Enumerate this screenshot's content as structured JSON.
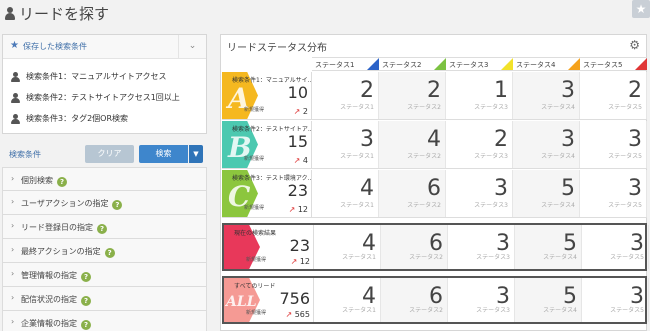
{
  "page": {
    "title": "リードを探す",
    "star_icon": "star-icon"
  },
  "saved": {
    "heading": "保存した検索条件",
    "items": [
      "検索条件1：マニュアルサイトアクセス",
      "検索条件2：テストサイトアクセス1回以上",
      "検索条件3：タグ2個OR検索"
    ]
  },
  "conditions": {
    "label": "検索条件",
    "clear": "クリア",
    "search": "検索",
    "filters": [
      "個別検索",
      "ユーザアクションの指定",
      "リード登録日の指定",
      "最終アクションの指定",
      "管理情報の指定",
      "配信状況の指定",
      "企業情報の指定"
    ]
  },
  "status": {
    "title": "リードステータス分布",
    "columns": [
      {
        "label": "ステータス1",
        "color": "#2c63c8"
      },
      {
        "label": "ステータス2",
        "color": "#7cc242"
      },
      {
        "label": "ステータス3",
        "color": "#f2e22a"
      },
      {
        "label": "ステータス4",
        "color": "#f5a21c"
      },
      {
        "label": "ステータス5",
        "color": "#e03535"
      }
    ],
    "rows": [
      {
        "name": "検索条件1：マニュアルサイ...",
        "count": "10",
        "sub": "新規獲得",
        "trend": "2",
        "letter": "A",
        "color": "#f5b820",
        "values": [
          "2",
          "2",
          "1",
          "3",
          "2"
        ]
      },
      {
        "name": "検索条件2：テストサイトア...",
        "count": "15",
        "sub": "新規獲得",
        "trend": "4",
        "letter": "B",
        "color": "#4cc9b0",
        "values": [
          "3",
          "4",
          "2",
          "3",
          "3"
        ]
      },
      {
        "name": "検索条件3：テスト環境アク...",
        "count": "23",
        "sub": "新規獲得",
        "trend": "12",
        "letter": "C",
        "color": "#8cc63e",
        "values": [
          "4",
          "6",
          "3",
          "5",
          "3"
        ]
      },
      {
        "name": "現在の検索結果",
        "count": "23",
        "sub": "新規獲得",
        "trend": "12",
        "letter": "",
        "color": "#e8385a",
        "values": [
          "4",
          "6",
          "3",
          "5",
          "3"
        ]
      },
      {
        "name": "すべてのリード",
        "count": "756",
        "sub": "新規獲得",
        "trend": "565",
        "letter": "ALL",
        "color": "#f59a94",
        "values": [
          "4",
          "6",
          "3",
          "5",
          "3"
        ]
      }
    ]
  }
}
